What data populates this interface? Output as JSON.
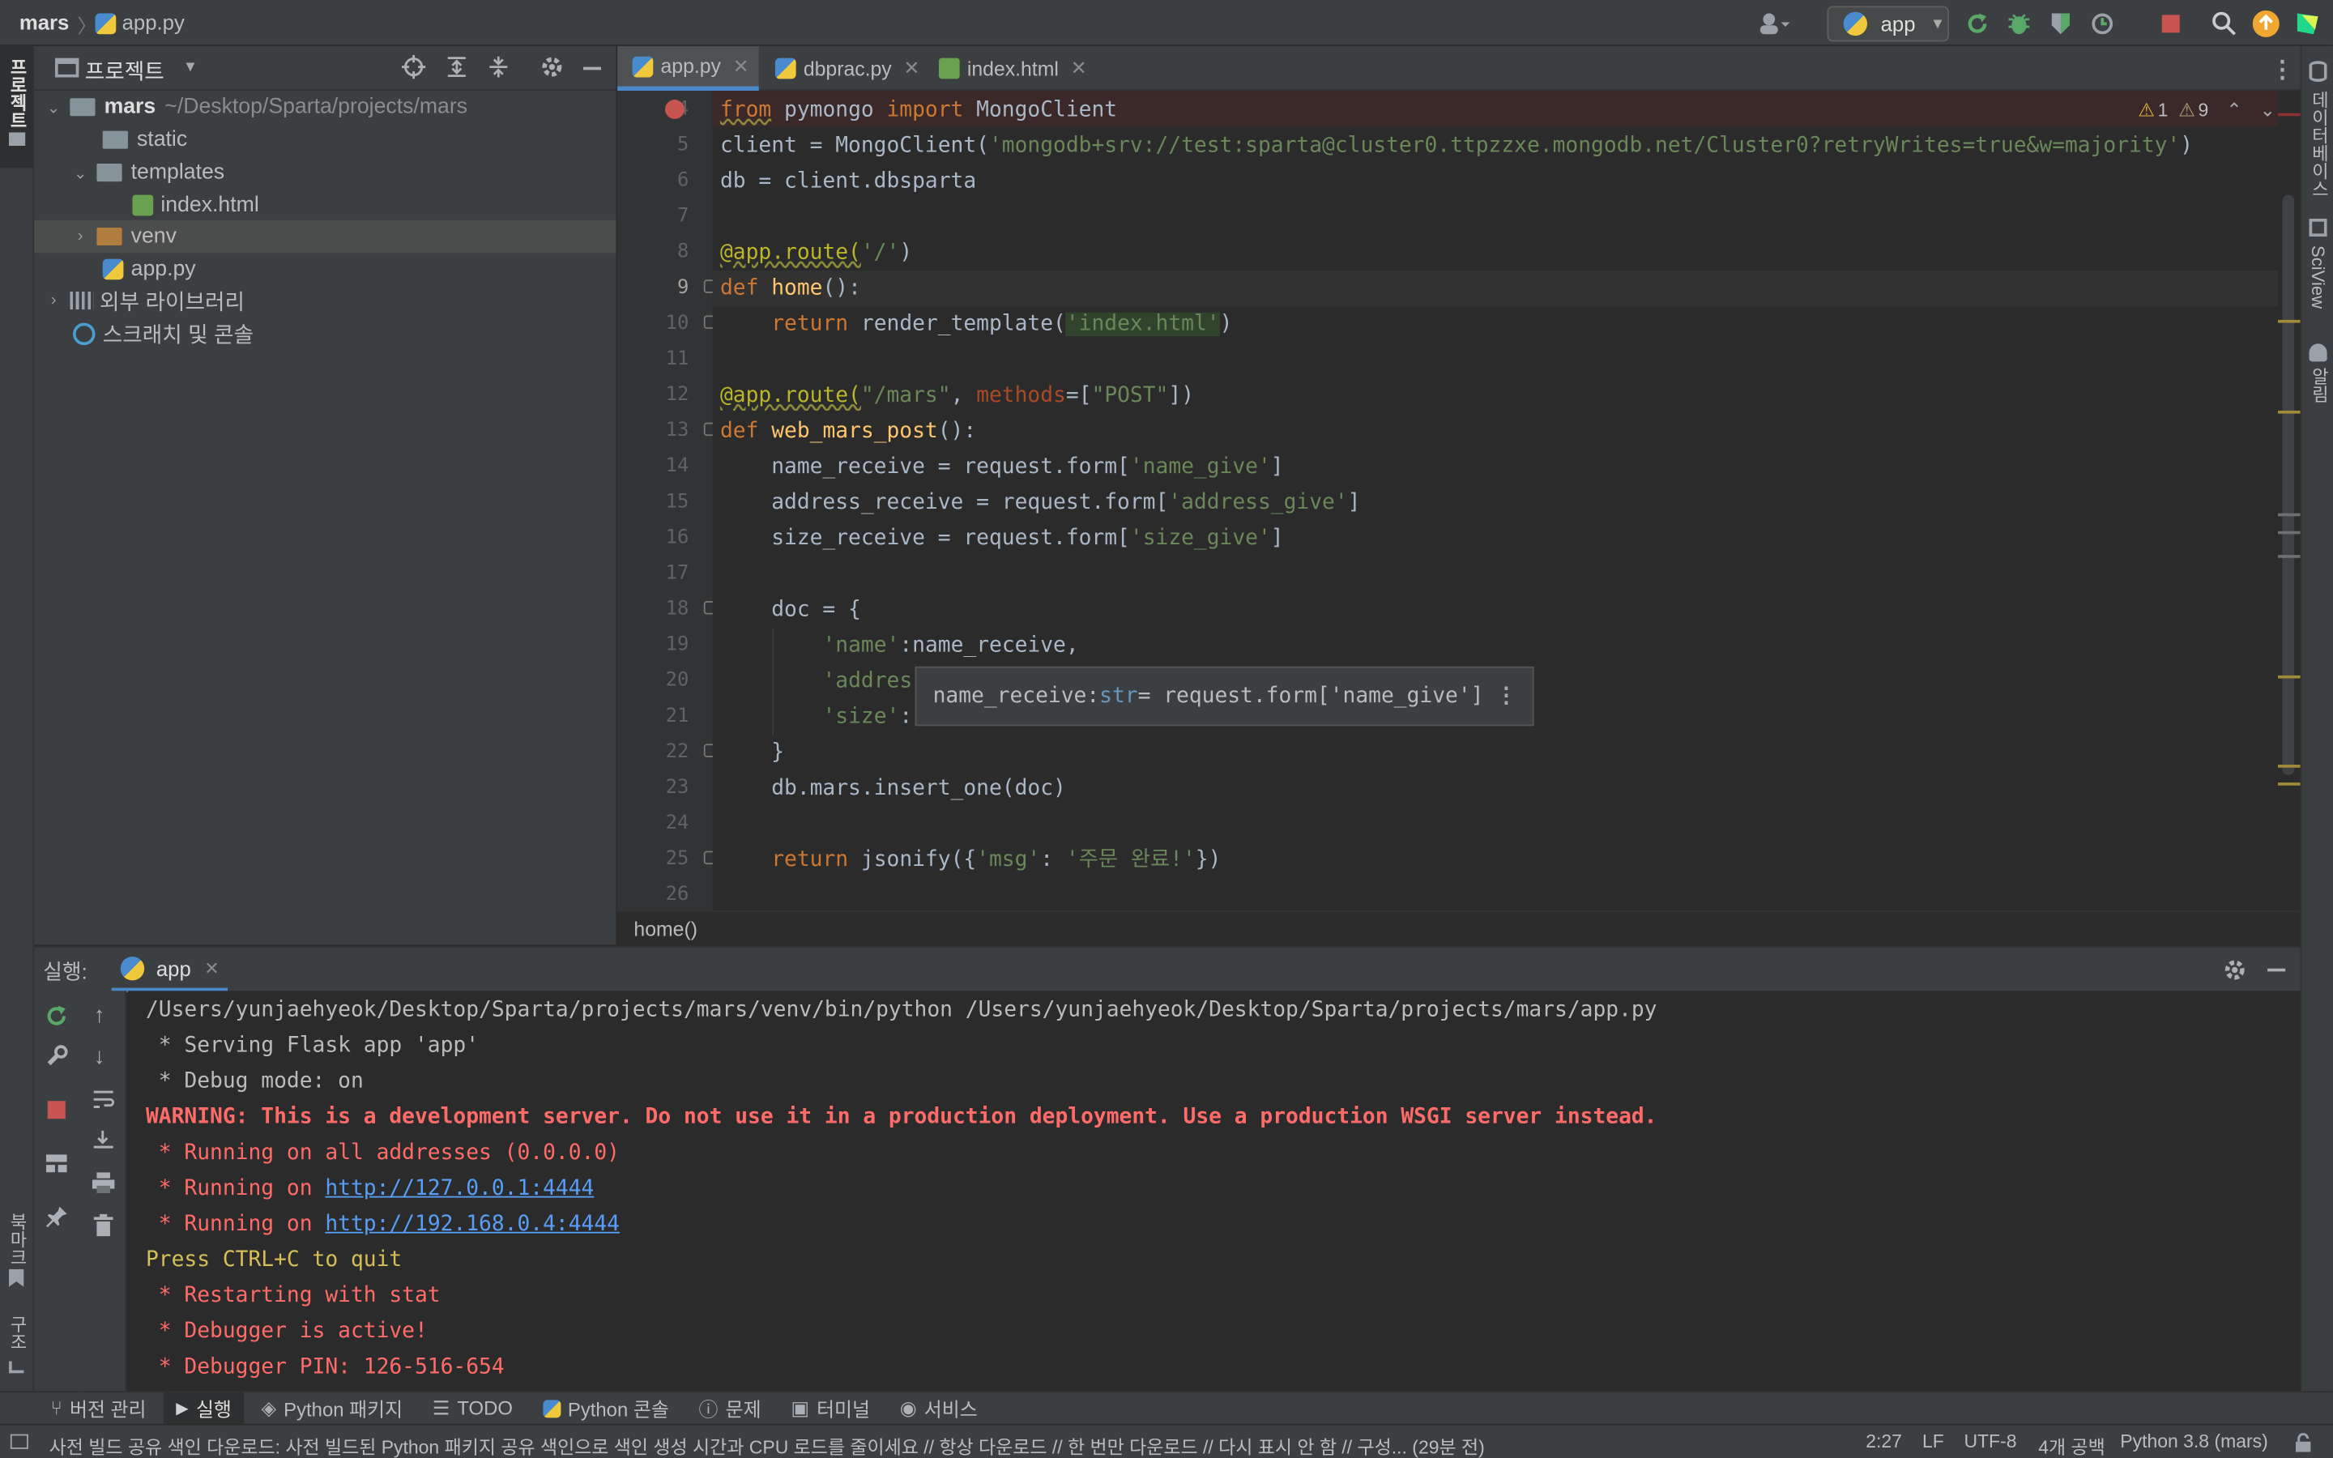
{
  "nav": {
    "project": "mars",
    "file": "app.py",
    "run_config": "app"
  },
  "left_strip": {
    "project_label": "프로젝트",
    "bookmarks_label": "북마크",
    "structure_label": "구조"
  },
  "right_strip": {
    "database_label": "데이터베이스",
    "sciview_label": "SciView",
    "notifications_label": "알림"
  },
  "project_panel": {
    "title": "프로젝트",
    "tree": [
      {
        "label": "mars",
        "path": "~/Desktop/Sparta/projects/mars"
      },
      {
        "label": "static"
      },
      {
        "label": "templates"
      },
      {
        "label": "index.html"
      },
      {
        "label": "venv"
      },
      {
        "label": "app.py"
      },
      {
        "label": "외부 라이브러리"
      },
      {
        "label": "스크래치 및 콘솔"
      }
    ]
  },
  "tabs": [
    {
      "label": "app.py"
    },
    {
      "label": "dbprac.py"
    },
    {
      "label": "index.html"
    }
  ],
  "inspection": {
    "warnings": "1",
    "weak_warnings": "9"
  },
  "editor": {
    "line_numbers": [
      "4",
      "5",
      "6",
      "7",
      "8",
      "9",
      "10",
      "11",
      "12",
      "13",
      "14",
      "15",
      "16",
      "17",
      "18",
      "19",
      "20",
      "21",
      "22",
      "23",
      "24",
      "25",
      "26"
    ],
    "l4": {
      "a": "from",
      "b": " pymongo ",
      "c": "import",
      "d": " MongoClient"
    },
    "l5": {
      "a": "client = MongoClient(",
      "b": "'mongodb+srv://test:sparta@cluster0.ttpzzxe.mongodb.net/Cluster0?retryWrites=true&w=majority'",
      "c": ")"
    },
    "l6": "db = client.dbsparta",
    "l8": {
      "a": "@app.route(",
      "b": "'/'",
      "c": ")"
    },
    "l9": {
      "a": "def ",
      "b": "home",
      "c": "():"
    },
    "l10": {
      "a": "    ",
      "b": "return",
      "c": " render_template(",
      "d": "'index.html'",
      "e": ")"
    },
    "l12": {
      "a": "@app.route(",
      "b": "\"/mars\"",
      "c": ", ",
      "d": "methods",
      "e": "=[",
      "f": "\"POST\"",
      "g": "])"
    },
    "l13": {
      "a": "def ",
      "b": "web_mars_post",
      "c": "():"
    },
    "l14": {
      "a": "    name_receive = request.form[",
      "b": "'name_give'",
      "c": "]"
    },
    "l15": {
      "a": "    address_receive = request.form[",
      "b": "'address_give'",
      "c": "]"
    },
    "l16": {
      "a": "    size_receive = request.form[",
      "b": "'size_give'",
      "c": "]"
    },
    "l18": "    doc = {",
    "l19": {
      "a": "        ",
      "b": "'name'",
      "c": ":name_receive,"
    },
    "l20": {
      "a": "        ",
      "b": "'addres"
    },
    "l21": {
      "a": "        ",
      "b": "'size'",
      "c": ":"
    },
    "l22": "    }",
    "l23": "    db.mars.insert_one(doc)",
    "l25": {
      "a": "    ",
      "b": "return",
      "c": " jsonify({",
      "d": "'msg'",
      "e": ": ",
      "f": "'주문 완료!'",
      "g": "})"
    }
  },
  "tooltip": {
    "a": "name_receive: ",
    "b": "str",
    "c": " = request.form['name_give']"
  },
  "breadcrumb": "home()",
  "run": {
    "label": "실행:",
    "tab": "app",
    "console": [
      {
        "text": "/Users/yunjaehyeok/Desktop/Sparta/projects/mars/venv/bin/python /Users/yunjaehyeok/Desktop/Sparta/projects/mars/app.py",
        "kind": "norm"
      },
      {
        "text": " * Serving Flask app 'app'",
        "kind": "norm"
      },
      {
        "text": " * Debug mode: on",
        "kind": "norm"
      },
      {
        "text": "WARNING: This is a development server. Do not use it in a production deployment. Use a production WSGI server instead.",
        "kind": "warn"
      },
      {
        "text": " * Running on all addresses (0.0.0.0)",
        "kind": "err"
      },
      {
        "text": " * Running on ",
        "kind": "err",
        "link": "http://127.0.0.1:4444"
      },
      {
        "text": " * Running on ",
        "kind": "err",
        "link": "http://192.168.0.4:4444"
      },
      {
        "text": "Press CTRL+C to quit",
        "kind": "yel"
      },
      {
        "text": " * Restarting with stat",
        "kind": "err"
      },
      {
        "text": " * Debugger is active!",
        "kind": "err"
      },
      {
        "text": " * Debugger PIN: 126-516-654",
        "kind": "err"
      }
    ]
  },
  "toolwindows": [
    {
      "label": "버전 관리"
    },
    {
      "label": "실행"
    },
    {
      "label": "Python 패키지"
    },
    {
      "label": "TODO"
    },
    {
      "label": "Python 콘솔"
    },
    {
      "label": "문제"
    },
    {
      "label": "터미널"
    },
    {
      "label": "서비스"
    }
  ],
  "status": {
    "message": "사전 빌드 공유 색인 다운로드: 사전 빌드된 Python 패키지 공유 색인으로 색인 생성 시간과 CPU 로드를 줄이세요 // 항상 다운로드 // 한 번만 다운로드 // 다시 표시 안 함 // 구성... (29분 전)",
    "position": "2:27",
    "line_sep": "LF",
    "encoding": "UTF-8",
    "indent": "4개 공백",
    "interpreter": "Python 3.8 (mars)"
  },
  "colors": {
    "accent": "#4a88c7",
    "keyword": "#cc7832",
    "string": "#6a8759",
    "decorator": "#bbb529",
    "function": "#ffc66d",
    "error": "#ff6b68",
    "link": "#589df6"
  }
}
